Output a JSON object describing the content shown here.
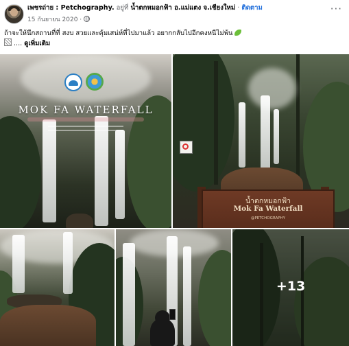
{
  "header": {
    "author": "เพชรถ่าย : Petchography.",
    "verb": " อยู่ที่ ",
    "location": "น้ำตกหมอกฟ้า อ.แม่แตง จ.เชียงใหม่",
    "separator": " · ",
    "follow_label": "ติดตาม",
    "date": "15 กันยายน 2020 ·",
    "privacy_icon": "globe-icon",
    "options_icon": "more-options-icon"
  },
  "caption": {
    "text": "ถ้าจะให้นึกสถานที่ที่ สงบ สวยและคุ้มเสน่ห์ที่ไปมาแล้ว อยากกลับไปอีกคงหนีไม่พ้น",
    "emoji_icon": "leaf-emoji-icon",
    "line2_prefix": "....",
    "see_more": "ดูเพิ่มเติม"
  },
  "photos": {
    "p1": {
      "title": "MOK FA WATERFALL",
      "logo_left": "department-logo-icon",
      "logo_right": "park-logo-icon"
    },
    "p2": {
      "sign_th": "น้ำตกหมอกฟ้า",
      "sign_en": "Mok Fa Waterfall",
      "sign_credit": "@PETCHOGRAPHY",
      "no_swim_icon": "prohibition-sign-icon"
    },
    "more_count": "+13"
  },
  "colors": {
    "link_blue": "#216fdb",
    "secondary_text": "#65676b",
    "primary_text": "#050505"
  }
}
